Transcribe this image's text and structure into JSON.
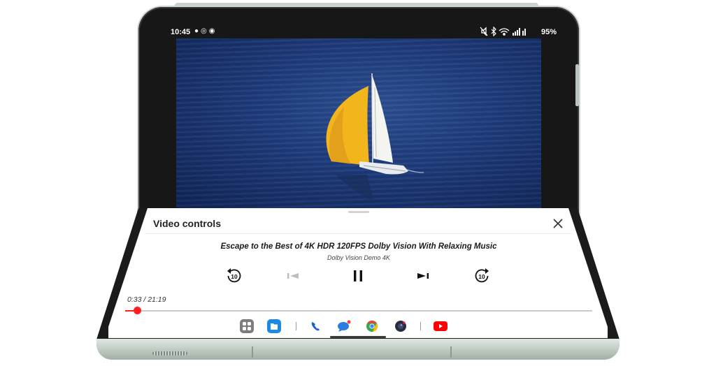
{
  "status_bar": {
    "time": "10:45",
    "left_icons": [
      "messenger-icon",
      "sync-icon",
      "account-icon"
    ],
    "right_icons": [
      "mute-icon",
      "bluetooth-icon",
      "wifi-icon",
      "signal-icon"
    ],
    "battery": "95%"
  },
  "video_player": {
    "scene": "sailboat-on-ocean"
  },
  "controls_panel": {
    "title": "Video controls",
    "video_title": "Escape to the Best of 4K HDR 120FPS Dolby Vision With Relaxing Music",
    "channel": "Dolby Vision Demo 4K",
    "rewind_label": "10",
    "forward_label": "10",
    "time_readout": "0:33 / 21:19",
    "progress_fraction": 0.0258,
    "buttons": [
      "rewind-10-button",
      "previous-button",
      "pause-button",
      "next-button",
      "forward-10-button"
    ]
  },
  "taskbar": {
    "apps": [
      "app-drawer-icon",
      "my-files-icon",
      "phone-icon",
      "messages-icon",
      "chrome-icon",
      "camera-icon",
      "youtube-icon"
    ]
  },
  "colors": {
    "accent": "#ff2020",
    "panel_background": "#ffffff",
    "screen_dark": "#171717"
  }
}
